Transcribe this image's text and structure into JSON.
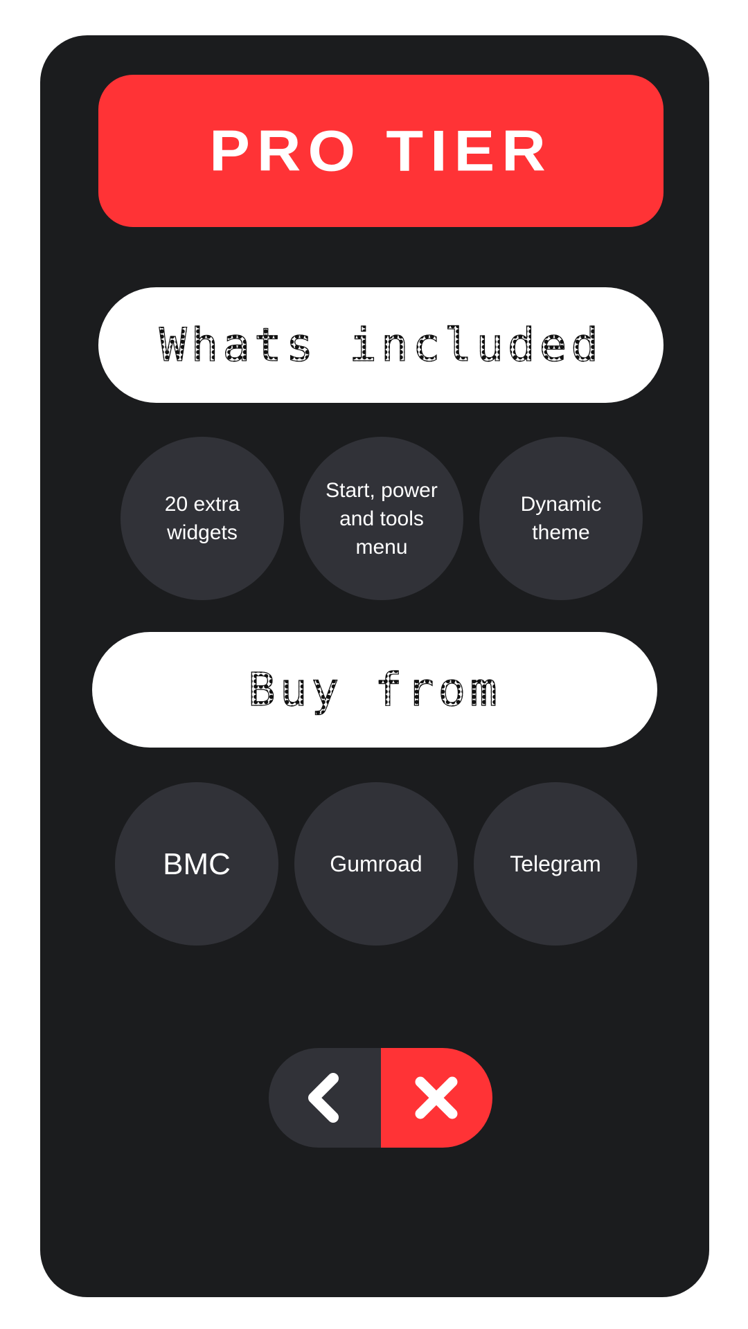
{
  "title": "PRO TIER",
  "included": {
    "heading": "Whats included",
    "items": [
      "20 extra widgets",
      "Start, power and tools menu",
      "Dynamic theme"
    ]
  },
  "buy": {
    "heading": "Buy from",
    "stores": [
      "BMC",
      "Gumroad",
      "Telegram"
    ]
  },
  "nav": {
    "back_icon": "chevron-left-icon",
    "close_icon": "close-icon"
  },
  "colors": {
    "background": "#ffffff",
    "card": "#1b1c1e",
    "accent": "#ff3336",
    "circle": "#313238",
    "pill": "#ffffff"
  }
}
